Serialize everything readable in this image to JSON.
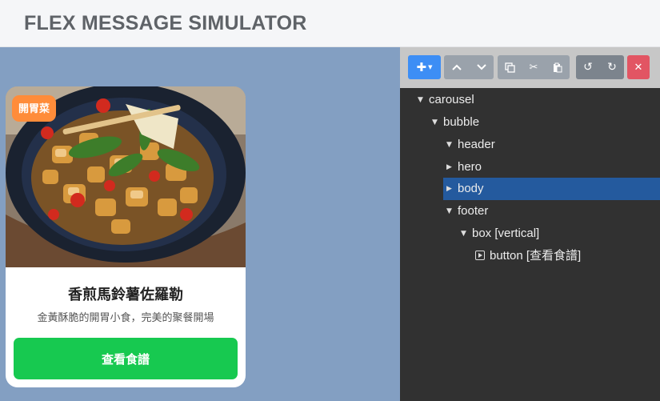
{
  "app": {
    "title": "FLEX MESSAGE SIMULATOR"
  },
  "preview": {
    "bubble": {
      "badge": "開胃菜",
      "title": "香煎馬鈴薯佐羅勒",
      "description": "金黃酥脆的開胃小食，完美的聚餐開場",
      "button_label": "查看食譜"
    }
  },
  "colors": {
    "accent": "#3d8ef5",
    "button_green": "#17c950",
    "badge_orange": "#ff8c3a",
    "preview_bg": "#839fc2",
    "tree_bg": "#313131",
    "selected": "#245a9e",
    "delete": "#e25563"
  },
  "toolbar": {
    "add_icon": "plus-dropdown-icon",
    "up_icon": "chevron-up-icon",
    "down_icon": "chevron-down-icon",
    "copy_icon": "copy-icon",
    "cut_icon": "scissors-icon",
    "paste_icon": "paste-icon",
    "undo_icon": "undo-icon",
    "redo_icon": "redo-icon",
    "delete_icon": "close-icon"
  },
  "tree": {
    "carousel": "carousel",
    "bubble": "bubble",
    "header": "header",
    "hero": "hero",
    "body": "body",
    "footer": "footer",
    "box": "box [vertical]",
    "button": "button [查看食譜]"
  }
}
